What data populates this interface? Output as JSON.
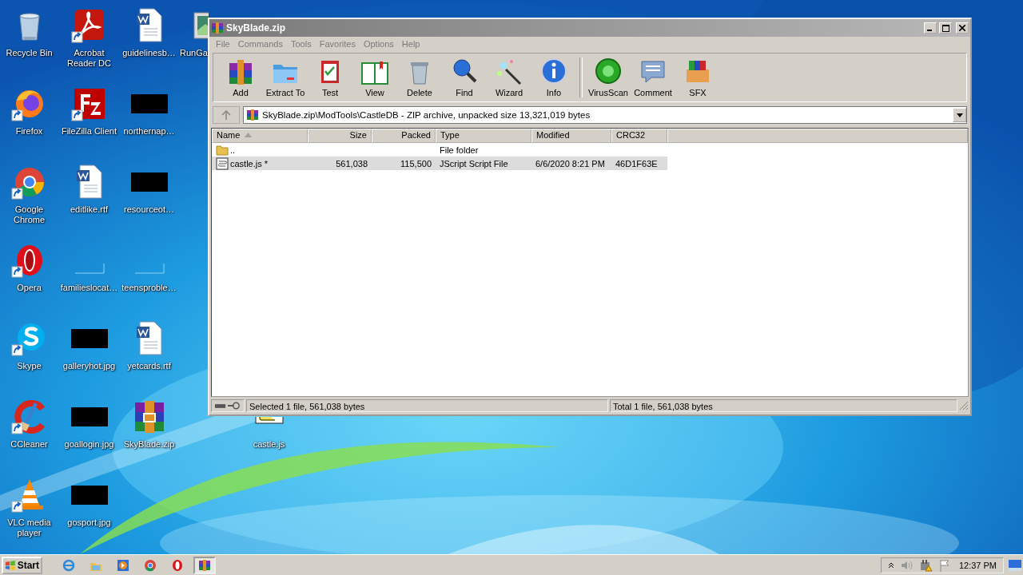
{
  "desktop": {
    "columns": [
      [
        {
          "label": "Recycle Bin",
          "kind": "bin",
          "shortcut": false
        },
        {
          "label": "Firefox",
          "kind": "firefox",
          "shortcut": true
        },
        {
          "label": "Google Chrome",
          "kind": "chrome",
          "shortcut": true
        },
        {
          "label": "Opera",
          "kind": "opera",
          "shortcut": true
        },
        {
          "label": "Skype",
          "kind": "skype",
          "shortcut": true
        },
        {
          "label": "CCleaner",
          "kind": "ccleaner",
          "shortcut": true
        },
        {
          "label": "VLC media player",
          "kind": "vlc",
          "shortcut": true
        }
      ],
      [
        {
          "label": "Acrobat Reader DC",
          "kind": "pdf",
          "shortcut": true
        },
        {
          "label": "FileZilla Client",
          "kind": "filezilla",
          "shortcut": true
        },
        {
          "label": "editlike.rtf",
          "kind": "doc",
          "shortcut": false
        },
        {
          "label": "familieslocat…",
          "kind": "blank",
          "shortcut": false
        },
        {
          "label": "galleryhot.jpg",
          "kind": "hidden",
          "shortcut": false
        },
        {
          "label": "goallogin.jpg",
          "kind": "hidden",
          "shortcut": false
        },
        {
          "label": "gosport.jpg",
          "kind": "hidden",
          "shortcut": false
        }
      ],
      [
        {
          "label": "guidelinesb…",
          "kind": "doc",
          "shortcut": false
        },
        {
          "label": "northernap…",
          "kind": "hidden",
          "shortcut": false
        },
        {
          "label": "resourceot…",
          "kind": "hidden",
          "shortcut": false
        },
        {
          "label": "teensproble…",
          "kind": "blank",
          "shortcut": false
        },
        {
          "label": "yetcards.rtf",
          "kind": "doc",
          "shortcut": false
        },
        {
          "label": "SkyBlade.zip",
          "kind": "archive",
          "shortcut": false
        }
      ],
      [
        {
          "label": "RunGa",
          "shortcut": false,
          "clipped_right": true
        }
      ],
      [
        {
          "kind": "empty"
        },
        {
          "kind": "empty"
        },
        {
          "kind": "empty"
        },
        {
          "kind": "empty"
        },
        {
          "kind": "empty"
        },
        {
          "label": "castle.js",
          "kind": "script",
          "shortcut": false,
          "clipped_top": true
        }
      ]
    ]
  },
  "window": {
    "title": "SkyBlade.zip",
    "menu": [
      "File",
      "Commands",
      "Tools",
      "Favorites",
      "Options",
      "Help"
    ],
    "toolbar": [
      "Add",
      "Extract To",
      "Test",
      "View",
      "Delete",
      "Find",
      "Wizard",
      "Info",
      "VirusScan",
      "Comment",
      "SFX"
    ],
    "address": "SkyBlade.zip\\ModTools\\CastleDB - ZIP archive, unpacked size 13,321,019 bytes",
    "columns": [
      {
        "label": "Name",
        "sorted": true
      },
      {
        "label": "Size",
        "sorted": false
      },
      {
        "label": "Packed",
        "sorted": false
      },
      {
        "label": "Type",
        "sorted": false
      },
      {
        "label": "Modified",
        "sorted": false
      },
      {
        "label": "CRC32",
        "sorted": false
      }
    ],
    "rows": [
      {
        "kind": "folder",
        "name": "..",
        "type": "File folder",
        "selected": false
      },
      {
        "kind": "script",
        "name": "castle.js *",
        "size": "561,038",
        "packed": "115,500",
        "type": "JScript Script File",
        "modified": "6/6/2020 8:21 PM",
        "crc32": "46D1F63E",
        "selected": true
      }
    ],
    "status": [
      "Selected 1 file, 561,038 bytes",
      "Total 1 file, 561,038 bytes"
    ]
  },
  "taskbar": {
    "start": "Start",
    "tasks": [
      {
        "selected": true
      }
    ],
    "clock": "12:37 PM"
  }
}
